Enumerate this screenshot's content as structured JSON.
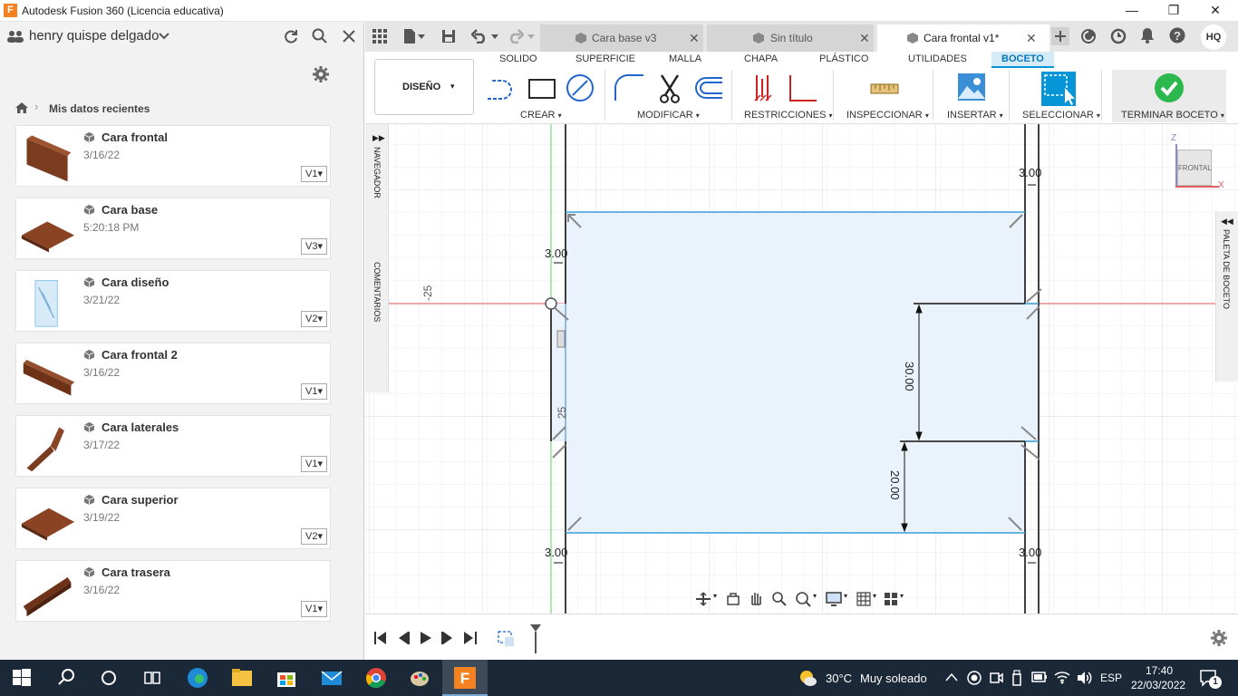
{
  "window": {
    "title": "Autodesk Fusion 360 (Licencia educativa)",
    "logo_letter": "F",
    "controls": {
      "minimize": "—",
      "maximize": "❐",
      "close": "✕"
    }
  },
  "data_panel": {
    "user": "henry quispe delgado",
    "breadcrumb": "Mis datos recientes",
    "items": [
      {
        "name": "Cara frontal",
        "date": "3/16/22",
        "version": "V1"
      },
      {
        "name": "Cara base",
        "date": "5:20:18 PM",
        "version": "V3"
      },
      {
        "name": "Cara diseño",
        "date": "3/21/22",
        "version": "V2"
      },
      {
        "name": "Cara frontal 2",
        "date": "3/16/22",
        "version": "V1"
      },
      {
        "name": "Cara laterales",
        "date": "3/17/22",
        "version": "V1"
      },
      {
        "name": "Cara superior",
        "date": "3/19/22",
        "version": "V2"
      },
      {
        "name": "Cara trasera",
        "date": "3/16/22",
        "version": "V1"
      }
    ]
  },
  "tabs": [
    {
      "label": "Cara base v3"
    },
    {
      "label": "Sin título"
    },
    {
      "label": "Cara frontal v1*"
    }
  ],
  "user_initials": "HQ",
  "ribbon": {
    "workspace": "DISEÑO",
    "tabs": [
      "SOLIDO",
      "SUPERFICIE",
      "MALLA",
      "CHAPA",
      "PLÁSTICO",
      "UTILIDADES",
      "BOCETO"
    ],
    "groups": [
      "CREAR",
      "MODIFICAR",
      "RESTRICCIONES",
      "INSPECCIONAR",
      "INSERTAR",
      "SELECCIONAR",
      "TERMINAR BOCETO"
    ]
  },
  "side_labels": {
    "navigator": "NAVEGADOR",
    "comments": "COMENTARIOS",
    "palette": "PALETA DE BOCETO"
  },
  "sketch": {
    "dims": {
      "top_right": "3.00",
      "left_upper": "3.00",
      "mid_right": "30.00",
      "lower_right": "20.00",
      "bottom_left": "3.00",
      "bottom_right": "3.00",
      "axis_label": "-25",
      "left_tag": "25"
    },
    "viewcube": {
      "face": "FRONTAL",
      "z": "Z",
      "x": "X"
    }
  },
  "taskbar": {
    "weather_temp": "30°C",
    "weather_text": "Muy soleado",
    "lang": "ESP",
    "time": "17:40",
    "date": "22/03/2022",
    "notifications": "1"
  },
  "colors": {
    "accent": "#0696d7",
    "sketch_fill": "#eaf3fb",
    "finish_green": "#2db84d"
  }
}
